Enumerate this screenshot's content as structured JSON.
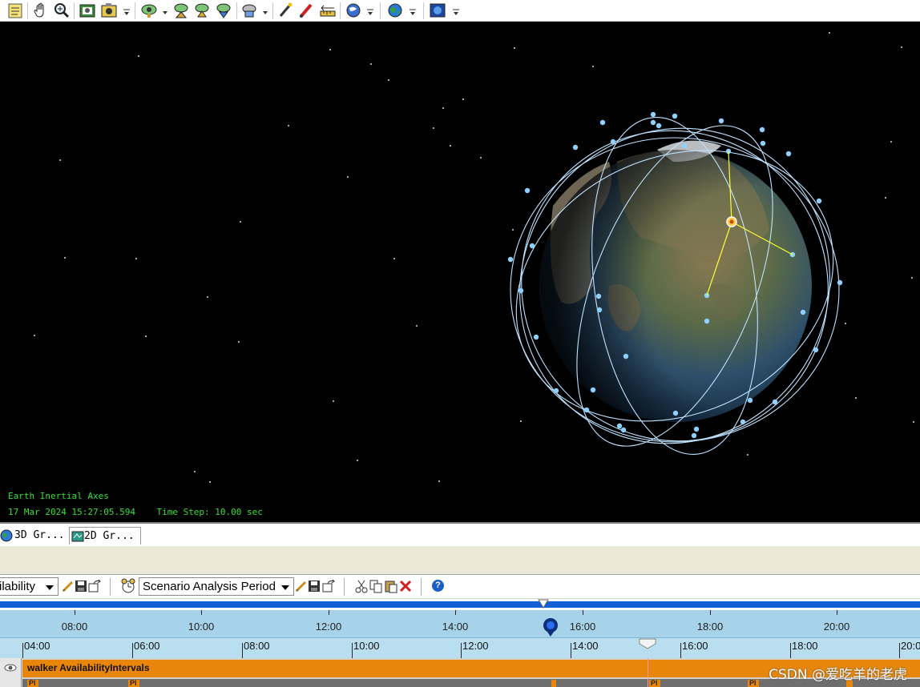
{
  "viewport": {
    "axes_label": "Earth Inertial Axes",
    "datetime": "17 Mar 2024 15:27:05.594",
    "time_step": "Time Step: 10.00 sec"
  },
  "tabs": [
    {
      "label": "3D Gr...",
      "icon": "globe-icon"
    },
    {
      "label": "2D Gr...",
      "icon": "map-icon"
    }
  ],
  "timeline_toolbar": {
    "content_select": "ilability",
    "period_select": "Scenario Analysis Period",
    "help_label": "?"
  },
  "timeline": {
    "top_axis_ticks": [
      "08:00",
      "10:00",
      "12:00",
      "14:00",
      "16:00",
      "18:00",
      "20:00"
    ],
    "bottom_axis_ticks": [
      "04:00",
      "06:00",
      "08:00",
      "10:00",
      "12:00",
      "14:00",
      "16:00",
      "18:00",
      "20:00"
    ],
    "row_label": "walker AvailabilityIntervals",
    "sub_chip_label": "Pl"
  },
  "colors": {
    "hud_text": "#35e035",
    "orbit": "#bfe3ff",
    "availability_bar": "#e8860c",
    "scrub_track": "#1060d8"
  },
  "watermark": "CSDN @爱吃羊的老虎"
}
